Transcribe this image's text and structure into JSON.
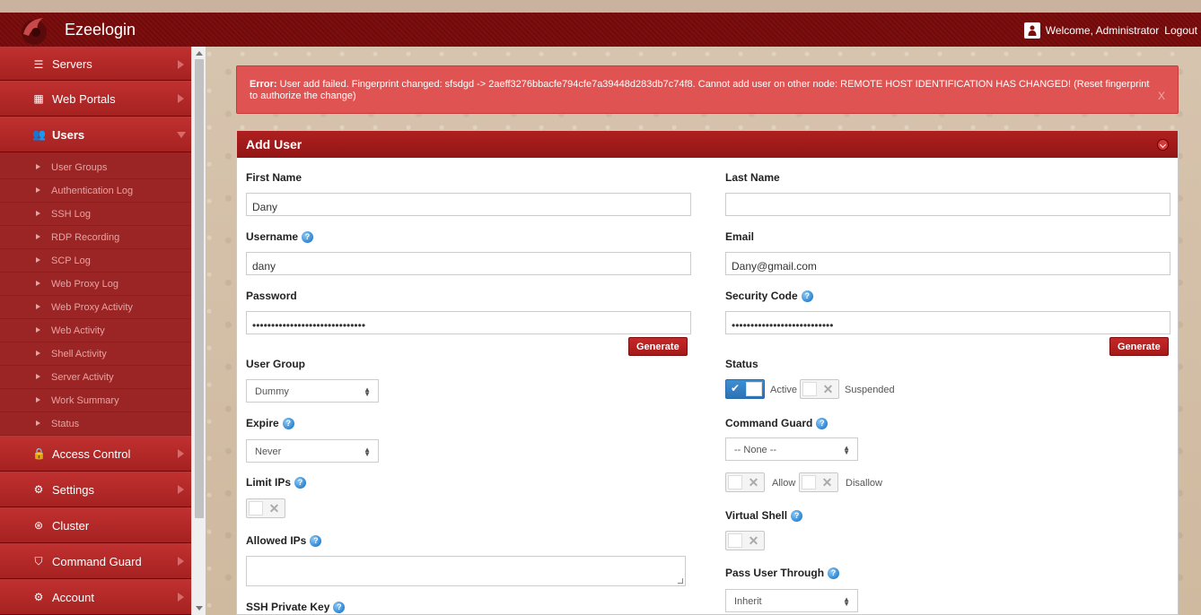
{
  "app": {
    "name": "Ezeelogin",
    "welcome": "Welcome, Administrator",
    "logout": "Logout"
  },
  "sidebar": {
    "items": [
      {
        "label": "Servers",
        "icon": "list-icon"
      },
      {
        "label": "Web Portals",
        "icon": "grid-icon"
      },
      {
        "label": "Users",
        "icon": "users-icon",
        "expanded": true
      },
      {
        "label": "Access Control",
        "icon": "lock-icon"
      },
      {
        "label": "Settings",
        "icon": "settings-icon"
      },
      {
        "label": "Cluster",
        "icon": "cluster-icon"
      },
      {
        "label": "Command Guard",
        "icon": "shield-icon"
      },
      {
        "label": "Account",
        "icon": "account-icon"
      }
    ],
    "users_sub": [
      "User Groups",
      "Authentication Log",
      "SSH Log",
      "RDP Recording",
      "SCP Log",
      "Web Proxy Log",
      "Web Proxy Activity",
      "Web Activity",
      "Shell Activity",
      "Server Activity",
      "Work Summary",
      "Status"
    ]
  },
  "alert": {
    "prefix": "Error:",
    "message": "User add failed. Fingerprint changed: sfsdgd -> 2aeff3276bbacfe794cfe7a39448d283db7c74f8. Cannot add user on other node: REMOTE HOST IDENTIFICATION HAS CHANGED! (Reset fingerprint to authorize the change)",
    "close": "X"
  },
  "panel": {
    "title": "Add User"
  },
  "form": {
    "first_name": {
      "label": "First Name",
      "value": "Dany"
    },
    "last_name": {
      "label": "Last Name",
      "value": ""
    },
    "username": {
      "label": "Username",
      "value": "dany"
    },
    "email": {
      "label": "Email",
      "value": "Dany@gmail.com"
    },
    "password": {
      "label": "Password",
      "value": "••••••••••••••••••••••••••••••"
    },
    "security_code": {
      "label": "Security Code",
      "value": "•••••••••••••••••••••••••••"
    },
    "generate": "Generate",
    "user_group": {
      "label": "User Group",
      "value": "Dummy"
    },
    "status": {
      "label": "Status",
      "active": "Active",
      "suspended": "Suspended",
      "value": "Active"
    },
    "expire": {
      "label": "Expire",
      "value": "Never"
    },
    "command_guard": {
      "label": "Command Guard",
      "value": "-- None --",
      "allow": "Allow",
      "disallow": "Disallow"
    },
    "limit_ips": {
      "label": "Limit IPs"
    },
    "virtual_shell": {
      "label": "Virtual Shell"
    },
    "allowed_ips": {
      "label": "Allowed IPs",
      "value": ""
    },
    "pass_user_through": {
      "label": "Pass User Through",
      "value": "Inherit"
    },
    "ssh_private_key": {
      "label": "SSH Private Key"
    }
  },
  "colors": {
    "brand": "#7d0f0f",
    "sidebar": "#a52221",
    "alert": "#e05353",
    "toggle_on": "#2e72b5"
  }
}
